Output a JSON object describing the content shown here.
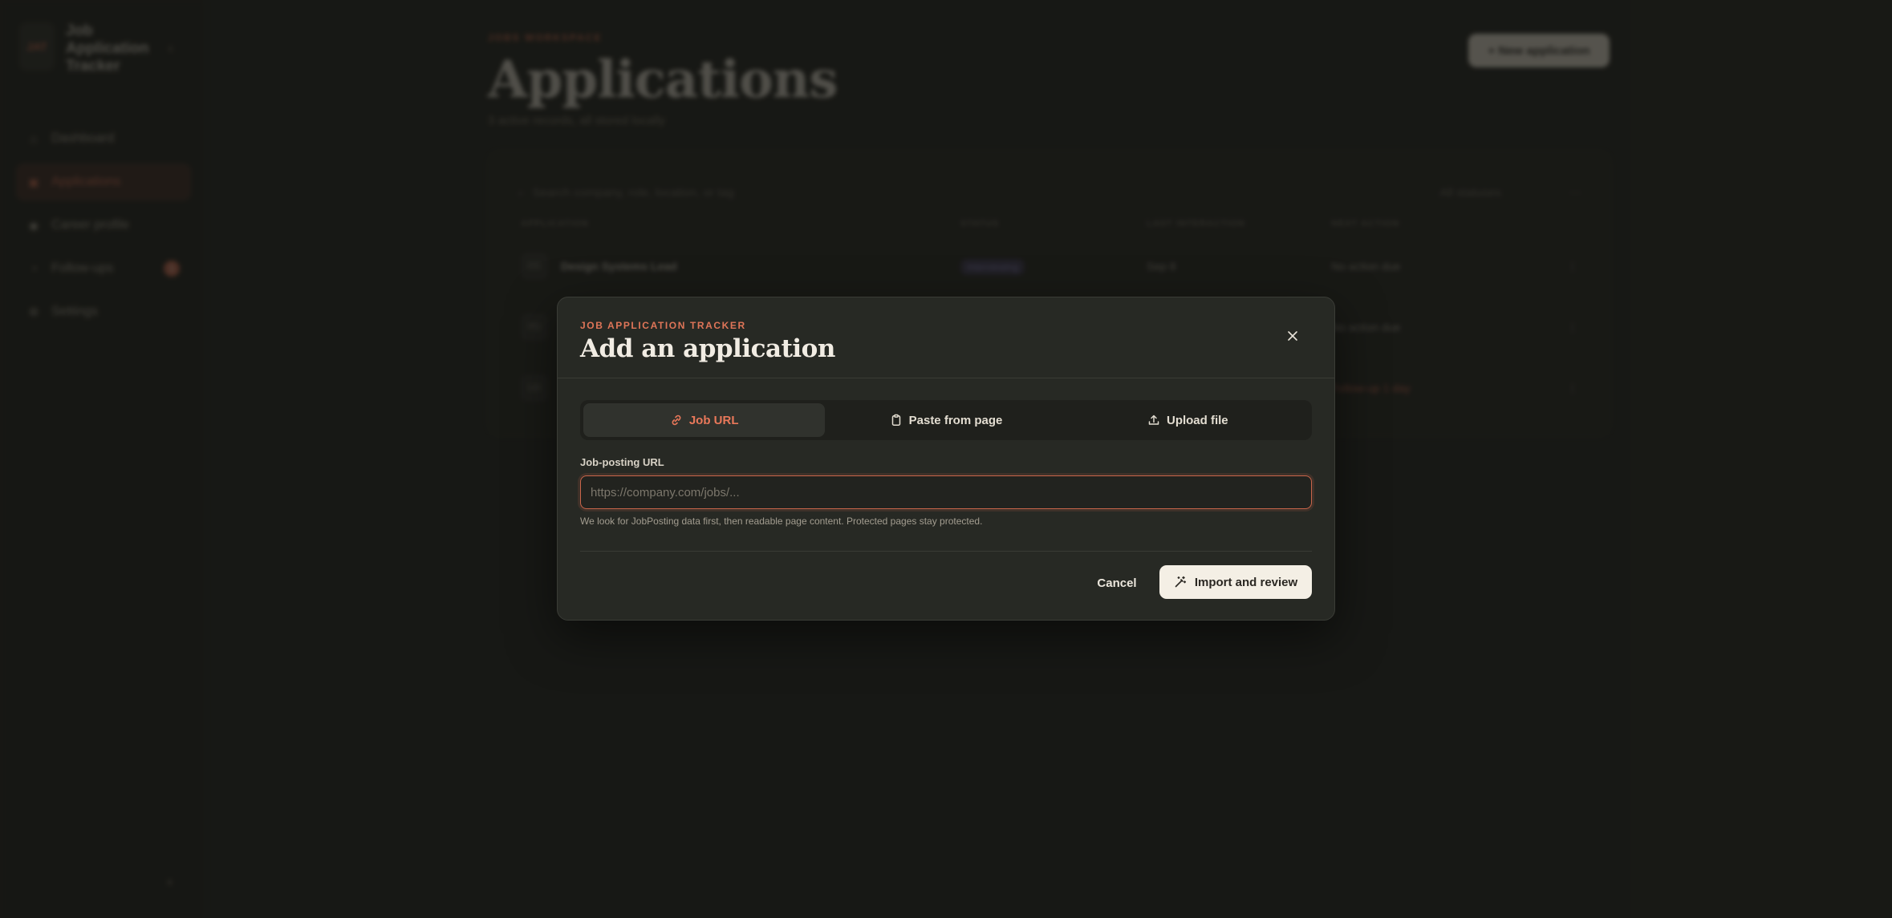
{
  "app": {
    "brand_mark": "JAT",
    "brand_name": "Job Application Tracker",
    "nav": [
      {
        "label": "Dashboard",
        "icon": "home-icon"
      },
      {
        "label": "Applications",
        "icon": "briefcase-icon"
      },
      {
        "label": "Career profile",
        "icon": "user-icon"
      },
      {
        "label": "Follow-ups",
        "icon": "bell-icon",
        "badge": "1"
      },
      {
        "label": "Settings",
        "icon": "gear-icon"
      }
    ]
  },
  "page": {
    "eyebrow": "JOBS WORKSPACE",
    "title": "Applications",
    "subtitle": "3 active records, all stored locally",
    "new_button": "+ New application",
    "search_placeholder": "Search company, role, location, or tag",
    "filter_label": "All statuses",
    "columns": [
      "APPLICATION",
      "STATUS",
      "LAST INTERACTION",
      "NEXT ACTION"
    ],
    "rows": [
      {
        "avatar": "DS",
        "role": "Design Systems Lead",
        "status": "Interviewing",
        "updated": "Sep 8",
        "next": "No action due"
      },
      {
        "avatar": "PD",
        "role": "",
        "status": "",
        "updated": "",
        "next": "No action due"
      },
      {
        "avatar": "UX",
        "role": "",
        "status": "",
        "updated": "",
        "next": "Follow-up 1 day",
        "late": true
      }
    ]
  },
  "modal": {
    "eyebrow": "JOB APPLICATION TRACKER",
    "title": "Add an application",
    "tabs": [
      {
        "label": "Job URL",
        "icon": "link-icon",
        "active": true
      },
      {
        "label": "Paste from page",
        "icon": "clipboard-icon",
        "active": false
      },
      {
        "label": "Upload file",
        "icon": "upload-icon",
        "active": false
      }
    ],
    "field_label": "Job-posting URL",
    "url_value": "",
    "url_placeholder": "https://company.com/jobs/...",
    "helper_text": "We look for JobPosting data first, then readable page content. Protected pages stay protected.",
    "cancel_label": "Cancel",
    "import_label": "Import and review"
  },
  "colors": {
    "accent": "#df7558",
    "modal_bg": "#272924",
    "page_bg": "#1d1e1a",
    "primary_button": "#f4efe5"
  }
}
